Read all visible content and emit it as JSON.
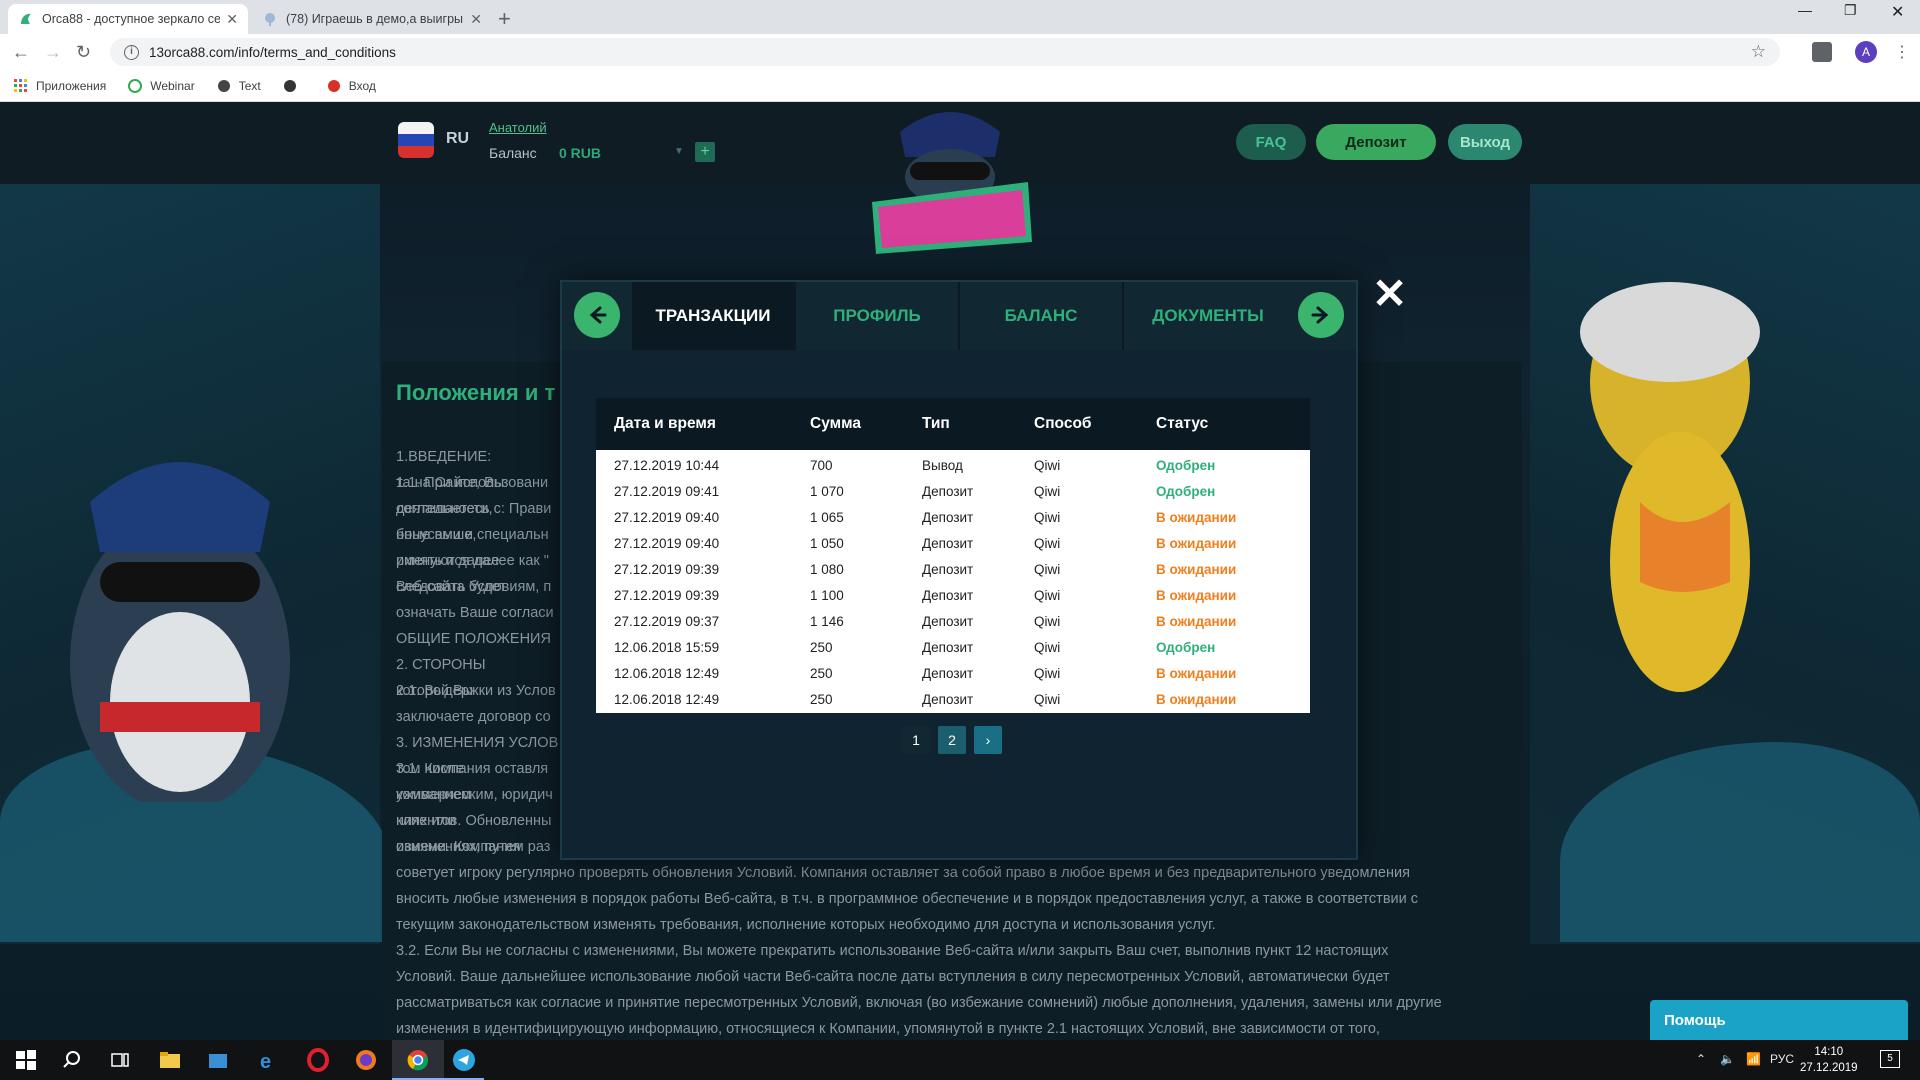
{
  "browser": {
    "tabs": [
      {
        "title": "Orca88 - доступное зеркало се",
        "active": true
      },
      {
        "title": "(78) Играешь в демо,а выигры",
        "active": false
      }
    ],
    "url": "13orca88.com/info/terms_and_conditions",
    "bookmarks": [
      "Приложения",
      "Webinar",
      "Text",
      "",
      "Вход"
    ],
    "profile_letter": "A"
  },
  "site": {
    "lang": "RU",
    "username": "Анатолий",
    "balance_label": "Баланс",
    "balance_value": "0 RUB",
    "buttons": {
      "faq": "FAQ",
      "deposit": "Депозит",
      "logout": "Выход"
    },
    "content_title": "Положения и т",
    "content_lines": [
      "1.ВВЕДЕНИЕ:",
      "1.1. При использовани",
      "соглашаетесь с: Прави",
      "бонусами и специальн",
      "именуются далее как \"",
      "следовать Условиям, п",
      "означать Ваше согласи",
      "ОБЩИЕ ПОЛОЖЕНИЯ",
      "2. СТОРОНЫ",
      "2.1. Выдержки из Услов",
      "заключаете договор со",
      "3. ИЗМЕНЕНИЯ УСЛОВ",
      "3.1. Компания оставля",
      "коммерческим, юридич",
      "клиентов. Обновленны",
      "изменениях, путем раз",
      "советует игроку регулярно проверять обновления Условий. Компания оставляет за собой право в любое время и без предварительного уведомления",
      "вносить любые изменения в порядок работы Веб-сайта, в т.ч. в программное обеспечение и в порядок предоставления услуг, а также в соответствии с",
      "текущим законодательством изменять требования, исполнение которых необходимо для доступа и использования услуг.",
      "3.2. Если Вы не согласны с изменениями, Вы можете прекратить использование Веб-сайта и/или закрыть Ваш счет, выполнив пункт 12 настоящих",
      "Условий. Ваше дальнейшее использование любой части Веб-сайта после даты вступления в силу пересмотренных Условий, автоматически будет",
      "рассматриваться как согласие и принятие пересмотренных Условий, включая (во избежание сомнений) любые дополнения, удаления, замены или другие",
      "изменения в идентифицирующую информацию, относящиеся к Компании, упомянутой в пункте 2.1 настоящих Условий, вне зависимости от того,"
    ],
    "content_right": [
      "та на Сайте, Вы",
      "деятельности,",
      "нные выше,",
      "ринять и далее",
      "Веб-сайта будет",
      "",
      "",
      "",
      "которой Вы",
      "",
      "",
      "том числе",
      "уживанием",
      "ниях или",
      "овиями. Компания"
    ],
    "help_label": "Помощь"
  },
  "modal": {
    "tabs": [
      "ТРАНЗАКЦИИ",
      "ПРОФИЛЬ",
      "БАЛАНС",
      "ДОКУМЕНТЫ"
    ],
    "columns": [
      "Дата и время",
      "Сумма",
      "Тип",
      "Способ",
      "Статус"
    ],
    "rows": [
      {
        "date": "27.12.2019 10:44",
        "amount": "700",
        "type": "Вывод",
        "method": "Qiwi",
        "status": "Одобрен",
        "state": "ok"
      },
      {
        "date": "27.12.2019 09:41",
        "amount": "1 070",
        "type": "Депозит",
        "method": "Qiwi",
        "status": "Одобрен",
        "state": "ok"
      },
      {
        "date": "27.12.2019 09:40",
        "amount": "1 065",
        "type": "Депозит",
        "method": "Qiwi",
        "status": "В ожидании",
        "state": "wait"
      },
      {
        "date": "27.12.2019 09:40",
        "amount": "1 050",
        "type": "Депозит",
        "method": "Qiwi",
        "status": "В ожидании",
        "state": "wait"
      },
      {
        "date": "27.12.2019 09:39",
        "amount": "1 080",
        "type": "Депозит",
        "method": "Qiwi",
        "status": "В ожидании",
        "state": "wait"
      },
      {
        "date": "27.12.2019 09:39",
        "amount": "1 100",
        "type": "Депозит",
        "method": "Qiwi",
        "status": "В ожидании",
        "state": "wait"
      },
      {
        "date": "27.12.2019 09:37",
        "amount": "1 146",
        "type": "Депозит",
        "method": "Qiwi",
        "status": "В ожидании",
        "state": "wait"
      },
      {
        "date": "12.06.2018 15:59",
        "amount": "250",
        "type": "Депозит",
        "method": "Qiwi",
        "status": "Одобрен",
        "state": "ok"
      },
      {
        "date": "12.06.2018 12:49",
        "amount": "250",
        "type": "Депозит",
        "method": "Qiwi",
        "status": "В ожидании",
        "state": "wait"
      },
      {
        "date": "12.06.2018 12:49",
        "amount": "250",
        "type": "Депозит",
        "method": "Qiwi",
        "status": "В ожидании",
        "state": "wait"
      }
    ],
    "pages": [
      "1",
      "2"
    ],
    "current_page": "1"
  },
  "taskbar": {
    "lang": "РУС",
    "time": "14:10",
    "date": "27.12.2019",
    "notifications": "5"
  },
  "colors": {
    "accent": "#2fb07a",
    "pending": "#f07f1d",
    "modal_bg": "#0f2430"
  }
}
